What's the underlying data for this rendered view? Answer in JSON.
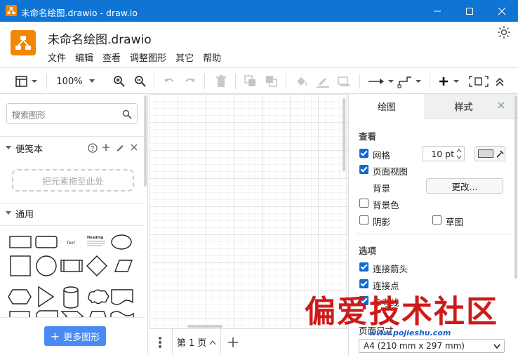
{
  "window": {
    "title": "未命名绘图.drawio - draw.io"
  },
  "header": {
    "doc_title": "未命名绘图.drawio",
    "menu": [
      "文件",
      "编辑",
      "查看",
      "调整图形",
      "其它",
      "帮助"
    ]
  },
  "toolbar": {
    "zoom": "100%"
  },
  "sidebar": {
    "search_placeholder": "搜索图形",
    "scratchpad_title": "便笺本",
    "dropzone_text": "把元素拖至此处",
    "general_title": "通用",
    "shape_text": "Text",
    "shape_heading": "Heading",
    "more_shapes": "更多图形"
  },
  "pages": {
    "current": "第 1 页"
  },
  "format_panel": {
    "tabs": [
      "绘图",
      "样式"
    ],
    "view_title": "查看",
    "grid_label": "网格",
    "grid_size": "10 pt",
    "page_view_label": "页面视图",
    "background_label": "背景",
    "change_button": "更改...",
    "background_color_label": "背景色",
    "shadow_label": "阴影",
    "sketch_label": "草图",
    "options_title": "选项",
    "connection_arrows_label": "连接箭头",
    "connection_points_label": "连接点",
    "guides_label": "参考线",
    "paper_size_label": "页面尺寸",
    "paper_size_value": "A4 (210 mm x 297 mm)"
  },
  "watermark": {
    "text": "偏爱技术社区",
    "url": "www.pojieshu.com"
  },
  "colors": {
    "titlebar": "#0f74d3",
    "brand": "#f08705",
    "accent": "#4a8af4",
    "watermark": "#cf1a1a"
  }
}
